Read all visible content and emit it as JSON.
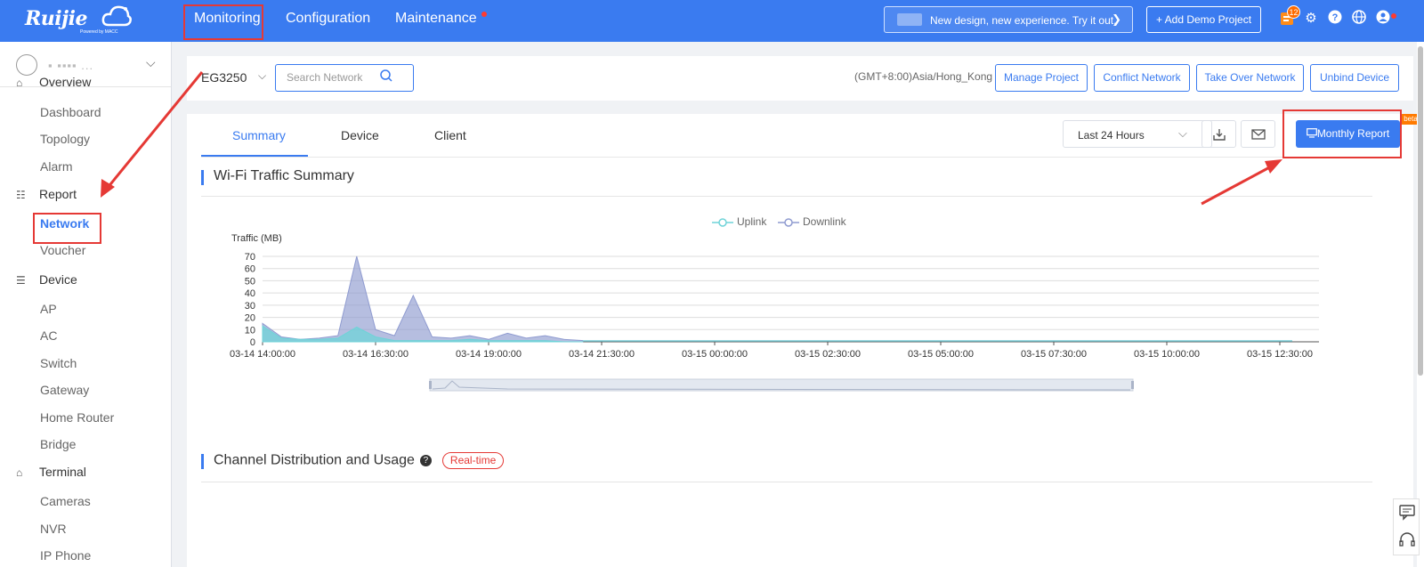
{
  "topbar": {
    "logo_text": "Ruijie",
    "logo_sub": "Powered by MACC",
    "nav": [
      "Monitoring",
      "Configuration",
      "Maintenance"
    ],
    "promo_text": "New design, new experience. Try it out.",
    "demo_button": "+ Add Demo Project",
    "notification_count": "12",
    "colors": {
      "bar": "#3a7bf0",
      "highlight": "#e53935"
    }
  },
  "sidebar": {
    "user_name": "▪ ▪▪▪▪ ...",
    "items": [
      {
        "type": "item",
        "label": "Overview"
      },
      {
        "type": "item",
        "label": "Dashboard"
      },
      {
        "type": "item",
        "label": "Topology"
      },
      {
        "type": "item",
        "label": "Alarm"
      },
      {
        "type": "group",
        "label": "Report",
        "icon": "report-icon"
      },
      {
        "type": "item",
        "label": "Network",
        "active": true
      },
      {
        "type": "item",
        "label": "Voucher"
      },
      {
        "type": "group",
        "label": "Device",
        "icon": "device-icon"
      },
      {
        "type": "item",
        "label": "AP"
      },
      {
        "type": "item",
        "label": "AC"
      },
      {
        "type": "item",
        "label": "Switch"
      },
      {
        "type": "item",
        "label": "Gateway"
      },
      {
        "type": "item",
        "label": "Home Router"
      },
      {
        "type": "item",
        "label": "Bridge"
      },
      {
        "type": "group",
        "label": "Terminal",
        "icon": "terminal-icon"
      },
      {
        "type": "item",
        "label": "Cameras"
      },
      {
        "type": "item",
        "label": "NVR"
      },
      {
        "type": "item",
        "label": "IP Phone"
      }
    ]
  },
  "netbar": {
    "network": "EG3250",
    "search_placeholder": "Search Network",
    "timezone": "(GMT+8:00)Asia/Hong_Kong",
    "actions": [
      "Manage Project",
      "Conflict Network",
      "Take Over Network",
      "Unbind Device"
    ]
  },
  "main": {
    "tabs": [
      "Summary",
      "Device",
      "Client"
    ],
    "range": "Last 24 Hours",
    "report_button": "Monthly Report",
    "beta": "beta",
    "section1": "Wi-Fi Traffic Summary",
    "section2": "Channel Distribution and Usage",
    "realtime": "Real-time"
  },
  "chart_data": {
    "type": "area",
    "title": "",
    "ylabel": "Traffic (MB)",
    "xlabel": "",
    "ylim": [
      0,
      70
    ],
    "yticks": [
      0,
      10,
      20,
      30,
      40,
      50,
      60,
      70
    ],
    "x_tick_labels": [
      "03-14 14:00:00",
      "03-14 16:30:00",
      "03-14 19:00:00",
      "03-14 21:30:00",
      "03-15 00:00:00",
      "03-15 02:30:00",
      "03-15 05:00:00",
      "03-15 07:30:00",
      "03-15 10:00:00",
      "03-15 12:30:00"
    ],
    "legend_position": "top-center",
    "series": [
      {
        "name": "Uplink",
        "color": "#6fd3d8",
        "values": [
          13,
          3,
          2,
          2,
          3,
          12,
          4,
          1,
          1,
          1,
          1,
          2,
          1,
          1,
          1,
          1,
          0,
          0
        ]
      },
      {
        "name": "Downlink",
        "color": "#8f9bd0",
        "values": [
          15,
          4,
          2,
          3,
          5,
          70,
          10,
          5,
          38,
          4,
          3,
          5,
          2,
          7,
          3,
          5,
          2,
          1
        ]
      }
    ],
    "points_per_tick": 6,
    "total_ticks": 10
  }
}
